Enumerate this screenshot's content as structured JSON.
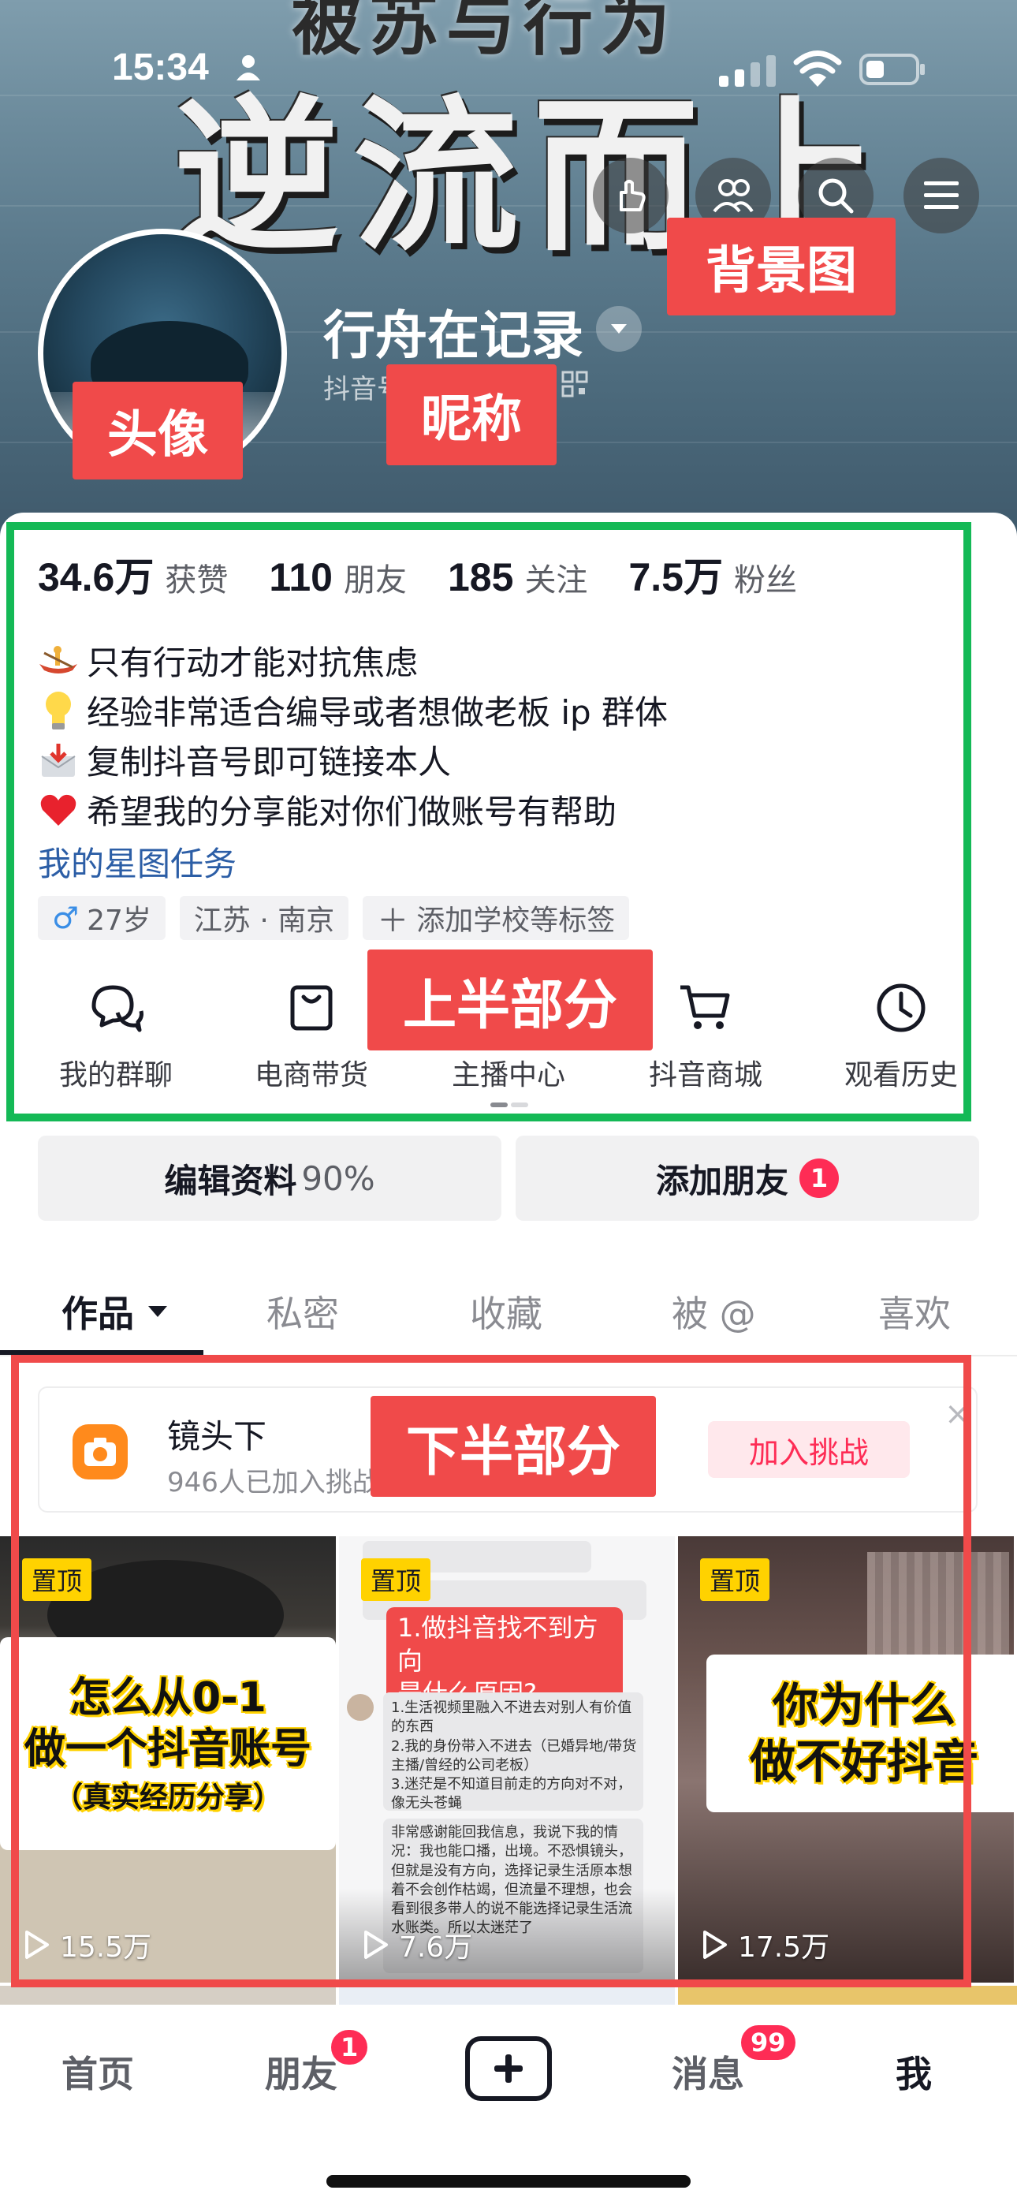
{
  "status_bar": {
    "time": "15:34"
  },
  "header": {
    "banner_top": "被苏与行为",
    "banner_main": "逆流而上",
    "nickname": "行舟在记录",
    "douyin_id": "抖音号"
  },
  "annotations": {
    "background": "背景图",
    "avatar": "头像",
    "nickname": "昵称",
    "upper_half": "上半部分",
    "lower_half": "下半部分"
  },
  "stats": [
    {
      "num": "34.6万",
      "label": "获赞"
    },
    {
      "num": "110",
      "label": "朋友"
    },
    {
      "num": "185",
      "label": "关注"
    },
    {
      "num": "7.5万",
      "label": "粉丝"
    }
  ],
  "bio": [
    {
      "icon": "canoe-icon",
      "text": "只有行动才能对抗焦虑"
    },
    {
      "icon": "lightbulb-icon",
      "text": "经验非常适合编导或者想做老板 ip 群体"
    },
    {
      "icon": "inbox-icon",
      "text": "复制抖音号即可链接本人"
    },
    {
      "icon": "heart-icon",
      "text": "希望我的分享能对你们做账号有帮助"
    }
  ],
  "star_task": "我的星图任务",
  "tags": {
    "age": "27岁",
    "location": "江苏 · 南京",
    "add": "添加学校等标签"
  },
  "tools": [
    {
      "icon": "group-chat-icon",
      "label": "我的群聊"
    },
    {
      "icon": "shopping-bag-icon",
      "label": "电商带货"
    },
    {
      "icon": "anchor-center-icon",
      "label": "主播中心"
    },
    {
      "icon": "cart-icon",
      "label": "抖音商城"
    },
    {
      "icon": "clock-icon",
      "label": "观看历史"
    }
  ],
  "actions": {
    "edit": "编辑资料",
    "edit_pct": "90%",
    "add_friend": "添加朋友",
    "add_friend_badge": "1"
  },
  "tabs": [
    "作品",
    "私密",
    "收藏",
    "被 @",
    "喜欢"
  ],
  "challenge": {
    "title": "镜头下",
    "subtitle": "946人已加入挑战",
    "join": "加入挑战",
    "close": "×"
  },
  "videos": [
    {
      "pin": "置顶",
      "cover": [
        "怎么从0-1",
        "做一个抖音账号",
        "（真实经历分享）"
      ],
      "plays": "15.5万"
    },
    {
      "pin": "置顶",
      "cover": [
        "1.做抖音找不到方向",
        "是什么原因?"
      ],
      "plays": "7.6万"
    },
    {
      "pin": "置顶",
      "cover": [
        "你为什么",
        "做不好抖音"
      ],
      "plays": "17.5万"
    }
  ],
  "chat_lines": [
    "1.生活视频里融入不进去对别人有价值的东西",
    "2.我的身份带入不进去（已婚异地/带货主播/曾经的公司老板）",
    "3.迷茫是不知道目前走的方向对不对，像无头苍蝇",
    "非常感谢能回我信息，我说下我的情况：我也能口播，出境。不恐惧镜头，但就是没有方向，选择记录生活原本想着不会创作枯竭，但流量不理想，也会看到很多带人的说不能选择记录生活流水账类。所以太迷茫了"
  ],
  "bottom_nav": {
    "home": "首页",
    "friends": "朋友",
    "friends_badge": "1",
    "messages": "消息",
    "messages_badge": "99",
    "me": "我"
  },
  "colors": {
    "accent": "#fe2c55",
    "annotation_red": "#f04a4a",
    "annotation_green": "#14b956",
    "link_blue": "#2c5ea6",
    "pin_yellow": "#ffd200"
  }
}
